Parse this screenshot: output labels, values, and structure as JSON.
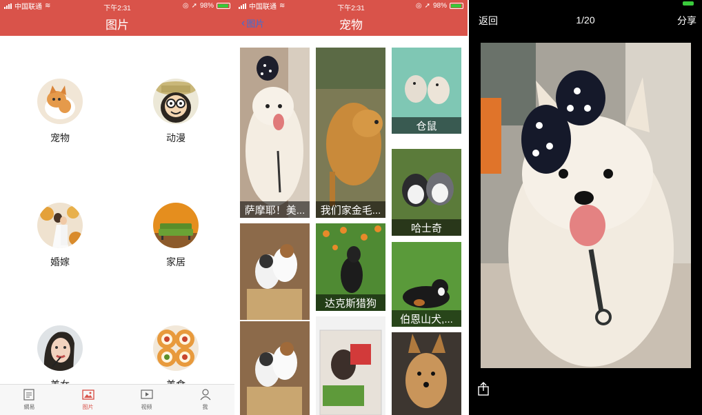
{
  "status": {
    "carrier": "中国联通",
    "time": "下午2:31",
    "battery": "98%"
  },
  "panel1": {
    "title": "图片",
    "categories": [
      {
        "label": "宠物",
        "icon": "pet-photo"
      },
      {
        "label": "动漫",
        "icon": "anime-photo"
      },
      {
        "label": "婚嫁",
        "icon": "wedding-photo"
      },
      {
        "label": "家居",
        "icon": "home-photo"
      },
      {
        "label": "美女",
        "icon": "beauty-photo"
      },
      {
        "label": "美食",
        "icon": "food-photo"
      }
    ],
    "tabs": [
      {
        "label": "網易",
        "icon": "news-icon",
        "active": false
      },
      {
        "label": "图片",
        "icon": "picture-icon",
        "active": true
      },
      {
        "label": "视频",
        "icon": "video-icon",
        "active": false
      },
      {
        "label": "我",
        "icon": "person-icon",
        "active": false
      }
    ]
  },
  "panel2": {
    "back_label": "图片",
    "title": "宠物",
    "tiles": [
      {
        "caption": "萨摩耶！美..."
      },
      {
        "caption": ""
      },
      {
        "caption": ""
      },
      {
        "caption": "我们家金毛..."
      },
      {
        "caption": "达克斯猎狗"
      },
      {
        "caption": ""
      },
      {
        "caption": "仓鼠"
      },
      {
        "caption": "哈士奇"
      },
      {
        "caption": "伯恩山犬,..."
      },
      {
        "caption": ""
      }
    ]
  },
  "panel3": {
    "back_label": "返回",
    "counter": "1/20",
    "share_label": "分享"
  },
  "colors": {
    "brand_red": "#d9534a",
    "link_blue": "#3a6fd9",
    "battery_green": "#37c93b"
  }
}
